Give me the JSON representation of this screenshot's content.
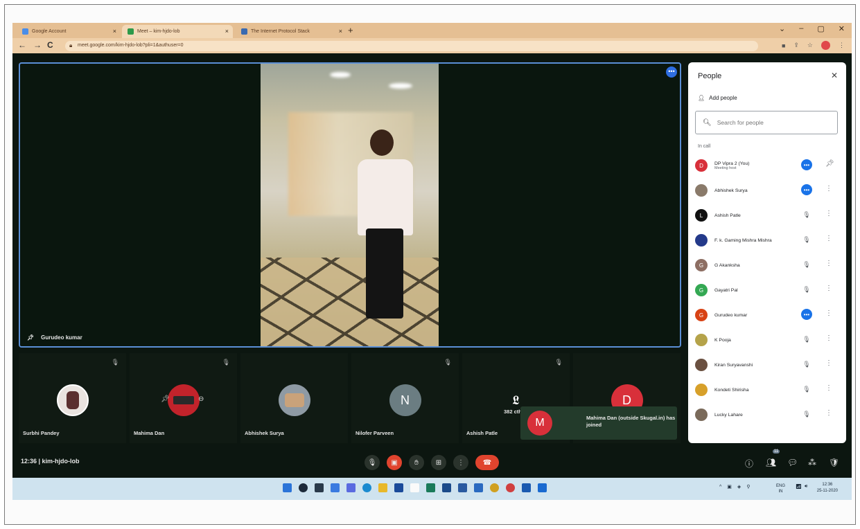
{
  "browser": {
    "tabs": [
      {
        "label": "Google Account",
        "close": "×"
      },
      {
        "label": "Meet – kim-hjdo-lob",
        "close": "×"
      },
      {
        "label": "The Internet Protocol Stack",
        "close": "×"
      }
    ],
    "new_tab": "+",
    "url": "meet.google.com/kim-hjdo-lob?pli=1&authuser=0",
    "window_controls": [
      "⌄",
      "–",
      "▢",
      "✕"
    ]
  },
  "meet": {
    "main_speaker": "Gurudeo kumar",
    "participants": [
      {
        "name": "Surbhi Pandey",
        "avatar_color": "#e9e3df"
      },
      {
        "name": "Mahima Dan",
        "avatar_color": "#c2232b"
      },
      {
        "name": "Abhishek Surya",
        "avatar_color": "#8e9aa4"
      },
      {
        "name": "Nilofer Parveen",
        "initial": "N",
        "avatar_color": "#6b7d82"
      },
      {
        "name": "Ashish Patle",
        "sub": "382 cth",
        "avatar_color": "#2a332c"
      },
      {
        "name": "",
        "initial": "D",
        "avatar_color": "#d8303a"
      }
    ],
    "joined_toast": {
      "initial": "M",
      "text": "Mahima Dan (outside Skugal.in) has joined"
    },
    "meeting_info": "12:36  |  kim-hjdo-lob",
    "people_badge": "11"
  },
  "panel": {
    "title": "People",
    "add_people": "Add people",
    "search_placeholder": "Search for people",
    "section": "In call",
    "people": [
      {
        "name": "DP Vipra 2 (You)",
        "role": "Meeting host",
        "initial": "D",
        "color": "#d8303a",
        "state": "more"
      },
      {
        "name": "Abhishek Surya",
        "initial": "",
        "color": "#8a7a6a",
        "state": "more"
      },
      {
        "name": "Ashish Patle",
        "initial": "L",
        "color": "#111111",
        "state": "muted"
      },
      {
        "name": "F. k. Gaming Mishra Mishra",
        "initial": "",
        "color": "#243a8a",
        "state": "muted"
      },
      {
        "name": "G Akanksha",
        "initial": "G",
        "color": "#8d6e63",
        "state": "muted"
      },
      {
        "name": "Gayatri Pal",
        "initial": "G",
        "color": "#34a853",
        "state": "muted"
      },
      {
        "name": "Gurudeo kumar",
        "initial": "G",
        "color": "#d84315",
        "state": "more"
      },
      {
        "name": "K Pooja",
        "initial": "",
        "color": "#b5a34a",
        "state": "muted"
      },
      {
        "name": "Kiran Suryavanshi",
        "initial": "",
        "color": "#6a5040",
        "state": "muted"
      },
      {
        "name": "Kondeti Shirisha",
        "initial": "",
        "color": "#d7a02a",
        "state": "muted"
      },
      {
        "name": "Lucky Lahare",
        "initial": "",
        "color": "#7a6a5a",
        "state": "muted"
      }
    ]
  },
  "taskbar": {
    "lang": "ENG\nIN",
    "time": "12:36",
    "date": "25-11-2020"
  }
}
